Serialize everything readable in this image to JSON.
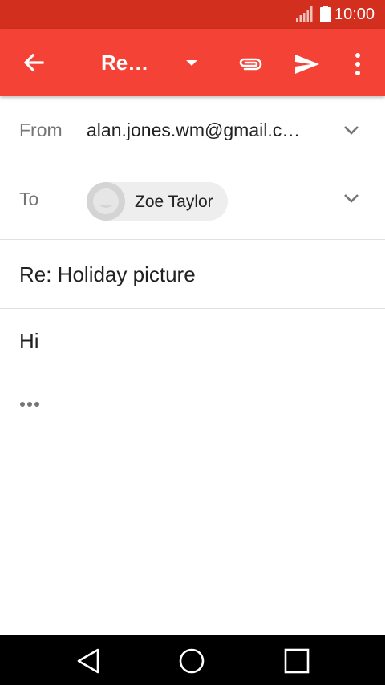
{
  "status_bar": {
    "time": "10:00",
    "signal_icon": "signal-icon",
    "battery_icon": "battery-icon"
  },
  "app_bar": {
    "title": "Re…",
    "back_icon": "back-arrow-icon",
    "dropdown_icon": "dropdown-triangle-icon",
    "attach_icon": "paperclip-icon",
    "send_icon": "send-icon",
    "more_icon": "more-vert-icon",
    "color": "#f44336"
  },
  "compose": {
    "from_label": "From",
    "from_value": "alan.jones.wm@gmail.c…",
    "to_label": "To",
    "recipient_name": "Zoe Taylor",
    "subject": "Re: Holiday picture",
    "body": "Hi",
    "quoted_text_icon": "ellipsis-icon"
  },
  "nav_bar": {
    "back": "nav-back-icon",
    "home": "nav-home-icon",
    "recents": "nav-recents-icon"
  }
}
